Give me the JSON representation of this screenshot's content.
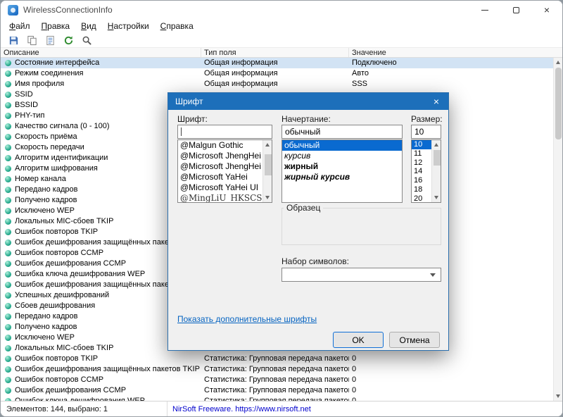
{
  "window": {
    "title": "WirelessConnectionInfo",
    "menu": [
      "Файл",
      "Правка",
      "Вид",
      "Настройки",
      "Справка"
    ],
    "toolbar_icons": [
      "save-icon",
      "copy-icon",
      "properties-icon",
      "refresh-icon",
      "find-icon"
    ],
    "status": {
      "items_count": "Элементов: 144, выбрано: 1",
      "link": "NirSoft Freeware. https://www.nirsoft.net"
    }
  },
  "table": {
    "columns": [
      "Описание",
      "Тип поля",
      "Значение"
    ],
    "rows": [
      {
        "d": "Состояние интерфейса",
        "t": "Общая информация",
        "v": "Подключено",
        "sel": true
      },
      {
        "d": "Режим соединения",
        "t": "Общая информация",
        "v": "Авто"
      },
      {
        "d": "Имя профиля",
        "t": "Общая информация",
        "v": "SSS"
      },
      {
        "d": "SSID",
        "t": "",
        "v": ""
      },
      {
        "d": "BSSID",
        "t": "",
        "v": ""
      },
      {
        "d": "PHY-тип",
        "t": "",
        "v": ""
      },
      {
        "d": "Качество сигнала (0 - 100)",
        "t": "",
        "v": ""
      },
      {
        "d": "Скорость приёма",
        "t": "",
        "v": ""
      },
      {
        "d": "Скорость передачи",
        "t": "",
        "v": ""
      },
      {
        "d": "Алгоритм идентификации",
        "t": "",
        "v": ""
      },
      {
        "d": "Алгоритм шифрования",
        "t": "",
        "v": ""
      },
      {
        "d": "Номер канала",
        "t": "",
        "v": ""
      },
      {
        "d": "Передано кадров",
        "t": "",
        "v": ""
      },
      {
        "d": "Получено кадров",
        "t": "",
        "v": ""
      },
      {
        "d": "Исключено WEP",
        "t": "",
        "v": ""
      },
      {
        "d": "Локальных MIC-сбоев TKIP",
        "t": "",
        "v": ""
      },
      {
        "d": "Ошибок повторов TKIP",
        "t": "",
        "v": ""
      },
      {
        "d": "Ошибок дешифрования защищённых пакетов TKIP",
        "t": "",
        "v": ""
      },
      {
        "d": "Ошибок повторов CCMP",
        "t": "",
        "v": ""
      },
      {
        "d": "Ошибок дешифрования CCMP",
        "t": "",
        "v": ""
      },
      {
        "d": "Ошибка ключа дешифрования WEP",
        "t": "",
        "v": ""
      },
      {
        "d": "Ошибок дешифрования защищённых пакетов WEP",
        "t": "",
        "v": ""
      },
      {
        "d": "Успешных дешифрований",
        "t": "",
        "v": ""
      },
      {
        "d": "Сбоев дешифрования",
        "t": "",
        "v": ""
      },
      {
        "d": "Передано кадров",
        "t": "",
        "v": ""
      },
      {
        "d": "Получено кадров",
        "t": "",
        "v": ""
      },
      {
        "d": "Исключено WEP",
        "t": "",
        "v": ""
      },
      {
        "d": "Локальных MIC-сбоев TKIP",
        "t": "",
        "v": ""
      },
      {
        "d": "Ошибок повторов TKIP",
        "t": "Статистика: Групповая передача пакетов",
        "v": "0"
      },
      {
        "d": "Ошибок дешифрования защищённых пакетов TKIP",
        "t": "Статистика: Групповая передача пакетов",
        "v": "0"
      },
      {
        "d": "Ошибок повторов CCMP",
        "t": "Статистика: Групповая передача пакетов",
        "v": "0"
      },
      {
        "d": "Ошибок дешифрования CCMP",
        "t": "Статистика: Групповая передача пакетов",
        "v": "0"
      },
      {
        "d": "Ошибок ключа дешифрования WEP",
        "t": "Статистика: Групповая передача пакетов",
        "v": "0"
      }
    ]
  },
  "font_dialog": {
    "title": "Шрифт",
    "labels": {
      "font": "Шрифт:",
      "style": "Начертание:",
      "size": "Размер:",
      "sample": "Образец",
      "charset": "Набор символов:"
    },
    "font_input": "",
    "style_input": "обычный",
    "size_input": "10",
    "fonts": [
      "@Malgun Gothic",
      "@Microsoft JhengHei",
      "@Microsoft JhengHei Light",
      "@Microsoft YaHei",
      "@Microsoft YaHei UI",
      "@MingLiU_HKSCS-ExtB"
    ],
    "styles": [
      "обычный",
      "курсив",
      "жирный",
      "жирный курсив"
    ],
    "style_selected": 0,
    "sizes": [
      "10",
      "11",
      "12",
      "14",
      "16",
      "18",
      "20"
    ],
    "size_selected": 0,
    "link": "Показать дополнительные шрифты",
    "ok": "OK",
    "cancel": "Отмена",
    "accent_color": "#1d6fba",
    "selection_color": "#0a6ad0"
  }
}
